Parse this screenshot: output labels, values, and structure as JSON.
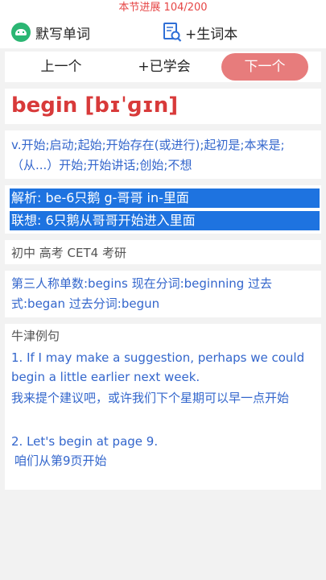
{
  "progress": {
    "text": "本节进展 104/200"
  },
  "toolbar": {
    "dictation_label": "默写单词",
    "new_words_label": "+生词本",
    "icons": {
      "dictation": "android-icon",
      "new_words": "book-search-icon"
    },
    "accent_color": "#2bb673"
  },
  "nav": {
    "prev_label": "上一个",
    "learned_label": "+已学会",
    "next_label": "下一个",
    "next_color": "#e77c7c"
  },
  "word": {
    "headword": "begin [bɪˈɡɪn]",
    "meaning": "v.开始;启动;起始;开始存在(或进行);起初是;本来是;（从...）开始;开始讲话;创始;不想",
    "analysis": "解析: be-6只鹅 g-哥哥 in-里面",
    "association": "联想: 6只鹅从哥哥开始进入里面",
    "levels": "初中 高考 CET4 考研",
    "forms": "第三人称单数:begins 现在分词:beginning 过去式:began 过去分词:begun",
    "headword_color": "#d83a3a",
    "highlight_color": "#1e73e0"
  },
  "examples": {
    "title": "牛津例句",
    "items": [
      {
        "en": "1. If I may make a suggestion, perhaps we could begin a little earlier next week.",
        "cn": "我来提个建议吧，或许我们下个星期可以早一点开始"
      },
      {
        "en": "2. Let's begin at page 9.",
        "cn": "咱们从第9页开始"
      }
    ]
  }
}
